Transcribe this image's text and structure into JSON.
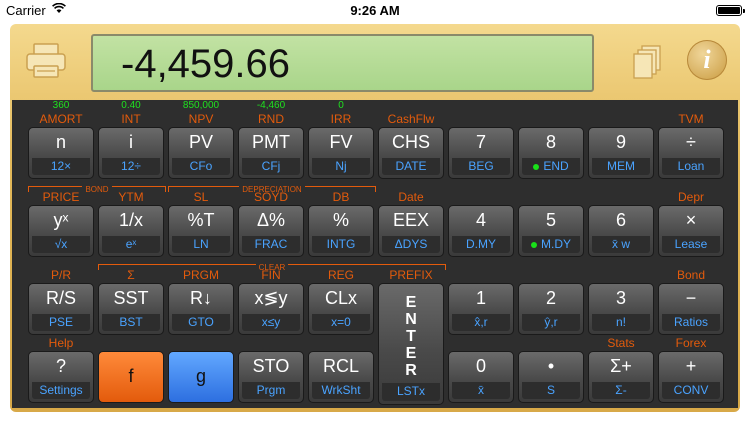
{
  "status": {
    "carrier": "Carrier",
    "time": "9:26 AM"
  },
  "display": {
    "value": "-4,459.66"
  },
  "info_label": "i",
  "registers": [
    "360",
    "0.40",
    "850,000",
    "-4,460",
    "0"
  ],
  "row1": [
    {
      "f": "AMORT",
      "top": "n",
      "bot": "12×"
    },
    {
      "f": "INT",
      "top": "i",
      "bot": "12÷"
    },
    {
      "f": "NPV",
      "top": "PV",
      "bot": "CFo"
    },
    {
      "f": "RND",
      "top": "PMT",
      "bot": "CFj"
    },
    {
      "f": "IRR",
      "top": "FV",
      "bot": "Nj"
    },
    {
      "f": "CashFlw",
      "top": "CHS",
      "bot": "DATE"
    },
    {
      "f": "",
      "top": "7",
      "bot": "BEG"
    },
    {
      "f": "",
      "top": "8",
      "bot": "END"
    },
    {
      "f": "",
      "top": "9",
      "bot": "MEM"
    },
    {
      "f": "TVM",
      "top": "÷",
      "bot": "Loan"
    }
  ],
  "row2": [
    {
      "f": "PRICE",
      "top": "yˣ",
      "bot": "√x"
    },
    {
      "f": "YTM",
      "top": "1/x",
      "bot": "eˣ"
    },
    {
      "f": "SL",
      "top": "%T",
      "bot": "LN"
    },
    {
      "f": "SOYD",
      "top": "Δ%",
      "bot": "FRAC"
    },
    {
      "f": "DB",
      "top": "%",
      "bot": "INTG"
    },
    {
      "f": "Date",
      "top": "EEX",
      "bot": "ΔDYS"
    },
    {
      "f": "",
      "top": "4",
      "bot": "D.MY"
    },
    {
      "f": "",
      "top": "5",
      "bot": "M.DY"
    },
    {
      "f": "",
      "top": "6",
      "bot": "x̄ w"
    },
    {
      "f": "Depr",
      "top": "×",
      "bot": "Lease"
    }
  ],
  "row3": [
    {
      "f": "P/R",
      "top": "R/S",
      "bot": "PSE"
    },
    {
      "f": "Σ",
      "top": "SST",
      "bot": "BST"
    },
    {
      "f": "PRGM",
      "top": "R↓",
      "bot": "GTO"
    },
    {
      "f": "FIN",
      "top": "x≶y",
      "bot": "x≤y"
    },
    {
      "f": "REG",
      "top": "CLx",
      "bot": "x=0"
    },
    {
      "f": "PREFIX",
      "top": "ENTER",
      "bot": "LSTx"
    },
    {
      "f": "",
      "top": "1",
      "bot": "x̂,r"
    },
    {
      "f": "",
      "top": "2",
      "bot": "ŷ,r"
    },
    {
      "f": "",
      "top": "3",
      "bot": "n!"
    },
    {
      "f": "Bond",
      "top": "−",
      "bot": "Ratios"
    }
  ],
  "row4": [
    {
      "f": "Help",
      "top": "?",
      "bot": "Settings"
    },
    {
      "f": "",
      "top": "f",
      "bot": ""
    },
    {
      "f": "",
      "top": "g",
      "bot": ""
    },
    {
      "f": "",
      "top": "STO",
      "bot": "Prgm"
    },
    {
      "f": "",
      "top": "RCL",
      "bot": "WrkSht"
    },
    {
      "f": "",
      "top": "0",
      "bot": "x̄"
    },
    {
      "f": "",
      "top": "•",
      "bot": "S"
    },
    {
      "f": "Stats",
      "top": "Σ+",
      "bot": "Σ-"
    },
    {
      "f": "Forex",
      "top": "+",
      "bot": "CONV"
    }
  ],
  "groups": {
    "bond": "BOND",
    "depreciation": "DEPRECIATION",
    "clear": "CLEAR"
  },
  "colors": {
    "accent_orange": "#e35b0c",
    "accent_blue": "#4aa3ff",
    "register_green": "#1fe21f",
    "lcd": "#b5db94",
    "gold": "#e3b95a"
  }
}
